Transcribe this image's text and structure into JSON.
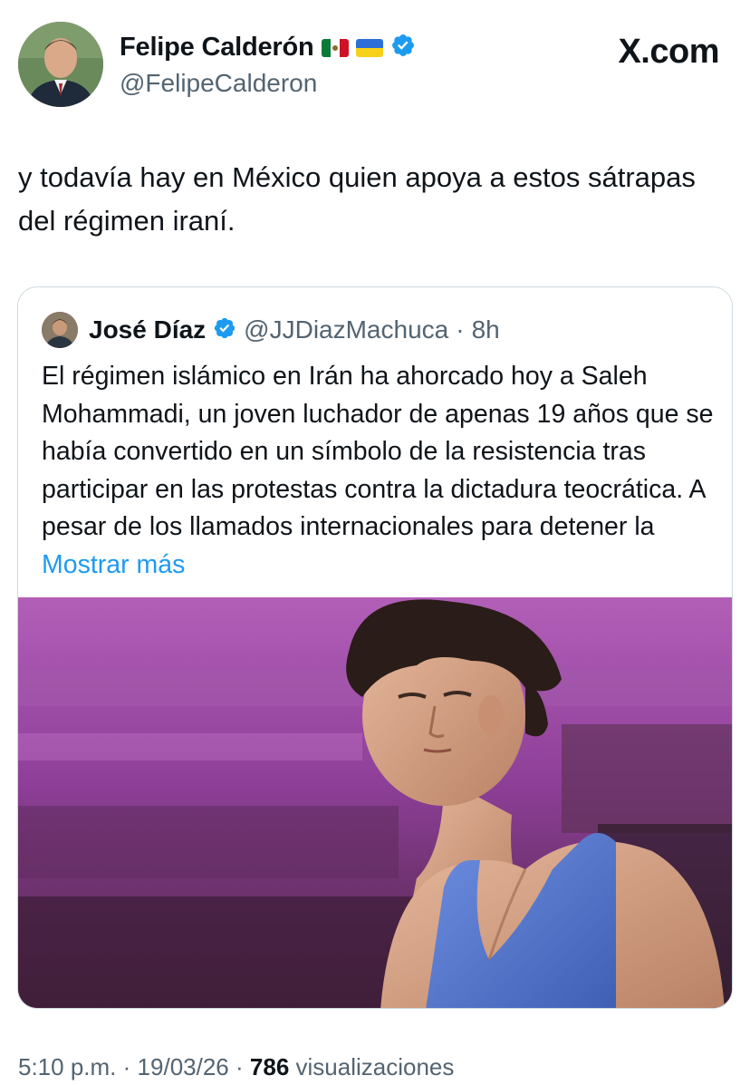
{
  "header": {
    "author_name": "Felipe Calderón",
    "author_handle": "@FelipeCalderon",
    "verified_icon": "verified-badge-icon",
    "flags": [
      "mexico-flag",
      "ukraine-flag"
    ],
    "brand": "X.com"
  },
  "tweet": {
    "text": "y todavía hay en México quien apoya a estos sátrapas del régimen iraní."
  },
  "quote": {
    "author_name": "José Díaz",
    "author_handle": "@JJDiazMachuca",
    "separator": "·",
    "time": "8h",
    "text": "El régimen islámico en Irán ha ahorcado hoy a Saleh Mohammadi, un joven luchador de apenas 19 años que se había convertido en un símbolo de la resistencia tras participar en las protestas contra la dictadura teocrática. A pesar de los llamados internacionales para detener la",
    "show_more": "Mostrar más",
    "media": "wrestler-photo"
  },
  "meta": {
    "time": "5:10 p.m.",
    "sep1": "·",
    "date": "19/03/26",
    "sep2": "·",
    "views_count": "786",
    "views_label": "visualizaciones"
  },
  "colors": {
    "link": "#1d9bf0",
    "secondary_text": "#536471",
    "border": "#cfd9de",
    "verified": "#1d9bf0"
  }
}
